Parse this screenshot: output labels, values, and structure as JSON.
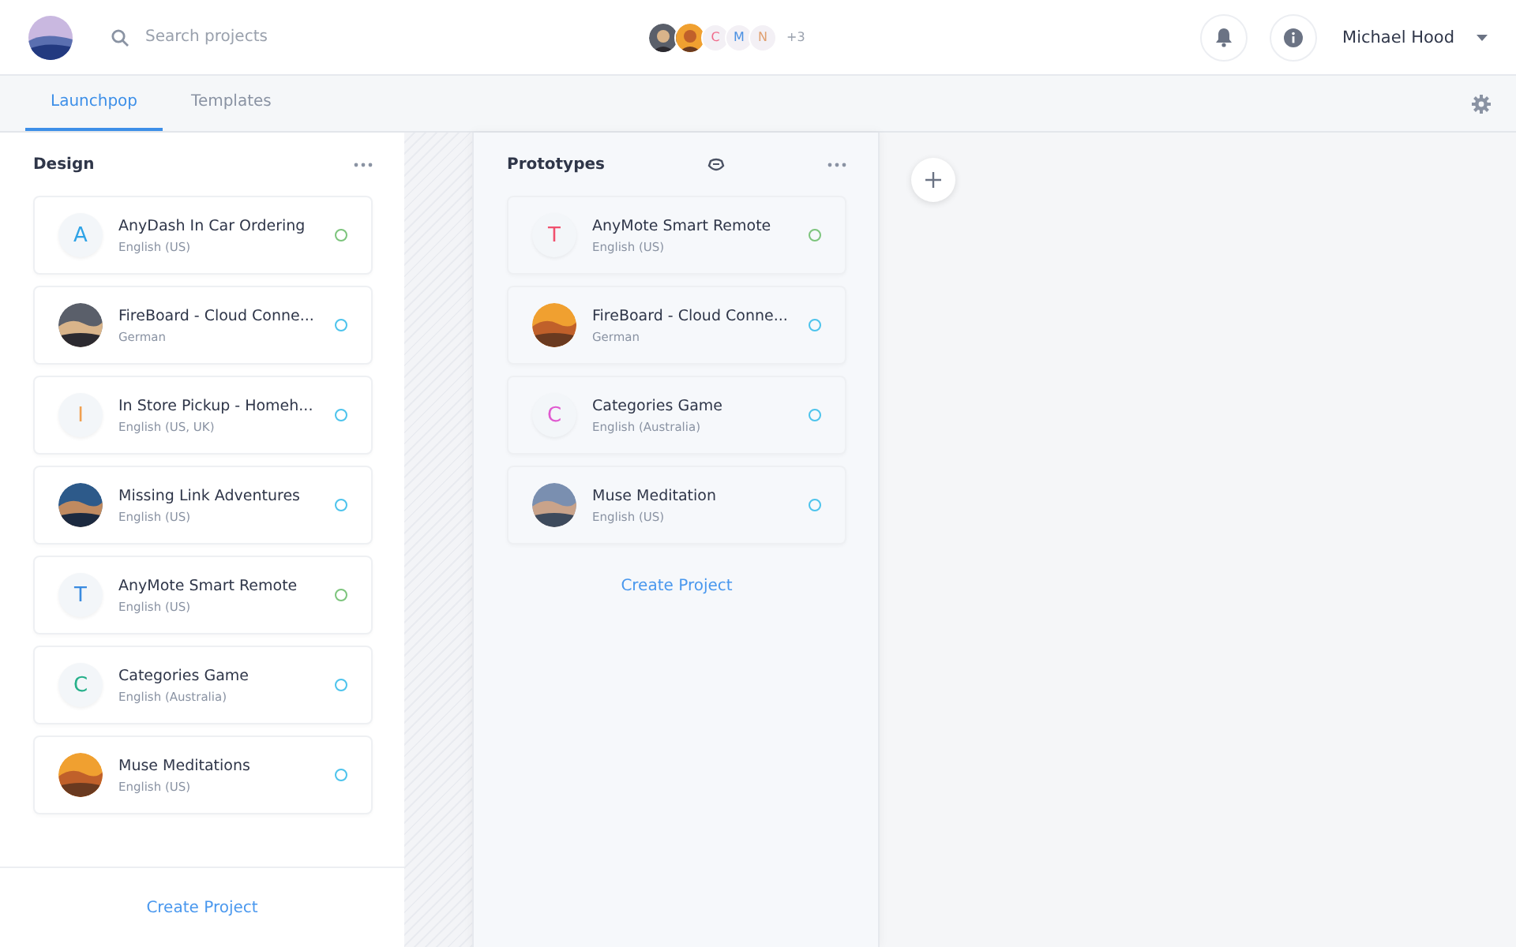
{
  "header": {
    "search": {
      "placeholder": "Search projects"
    },
    "collaborators": [
      {
        "kind": "picture"
      },
      {
        "kind": "picture"
      },
      {
        "kind": "letter",
        "letter": "C",
        "color": "#f06a8a"
      },
      {
        "kind": "letter",
        "letter": "M",
        "color": "#4a90e2"
      },
      {
        "kind": "letter",
        "letter": "N",
        "color": "#e0a070"
      }
    ],
    "more_count": "+3",
    "user": "Michael Hood"
  },
  "tabs": [
    {
      "label": "Launchpop",
      "selected": true
    },
    {
      "label": "Templates",
      "selected": false
    }
  ],
  "columns": [
    {
      "title": "Design",
      "highlighted": false,
      "has_badge_icon": false,
      "footer": "Create Project",
      "projects": [
        {
          "name": "AnyDash In Car Ordering",
          "language": "English (US)",
          "avatar": {
            "kind": "letter",
            "letter": "A",
            "color": "#2fa3e6"
          },
          "color": "#7cc47c"
        },
        {
          "name": "FireBoard - Cloud Conne...",
          "language": "German",
          "avatar": {
            "kind": "picture"
          },
          "color": "#4cc3ec"
        },
        {
          "name": "In Store Pickup - Homeh...",
          "language": "English (US, UK)",
          "avatar": {
            "kind": "letter",
            "letter": "I",
            "color": "#f0a050"
          },
          "color": "#4cc3ec"
        },
        {
          "name": "Missing Link Adventures",
          "language": "English (US)",
          "avatar": {
            "kind": "picture"
          },
          "color": "#4cc3ec"
        },
        {
          "name": "AnyMote Smart Remote",
          "language": "English (US)",
          "avatar": {
            "kind": "letter",
            "letter": "T",
            "color": "#3a8be0"
          },
          "color": "#7cc47c"
        },
        {
          "name": "Categories Game",
          "language": "English (Australia)",
          "avatar": {
            "kind": "letter",
            "letter": "C",
            "color": "#26b08a"
          },
          "color": "#4cc3ec"
        },
        {
          "name": "Muse Meditations",
          "language": "English (US)",
          "avatar": {
            "kind": "picture"
          },
          "color": "#4cc3ec"
        }
      ]
    },
    {
      "title": "Prototypes",
      "highlighted": true,
      "has_badge_icon": true,
      "footer": "Create Project",
      "projects": [
        {
          "name": "AnyMote Smart Remote",
          "language": "English (US)",
          "avatar": {
            "kind": "letter",
            "letter": "T",
            "color": "#f0506e"
          },
          "color": "#7cc47c"
        },
        {
          "name": "FireBoard - Cloud Conne...",
          "language": "German",
          "avatar": {
            "kind": "picture"
          },
          "color": "#4cc3ec"
        },
        {
          "name": "Categories Game",
          "language": "English (Australia)",
          "avatar": {
            "kind": "letter",
            "letter": "C",
            "color": "#e05ad0"
          },
          "color": "#4cc3ec"
        },
        {
          "name": "Muse Meditation",
          "language": "English (US)",
          "avatar": {
            "kind": "picture"
          },
          "color": "#4cc3ec"
        }
      ]
    }
  ]
}
